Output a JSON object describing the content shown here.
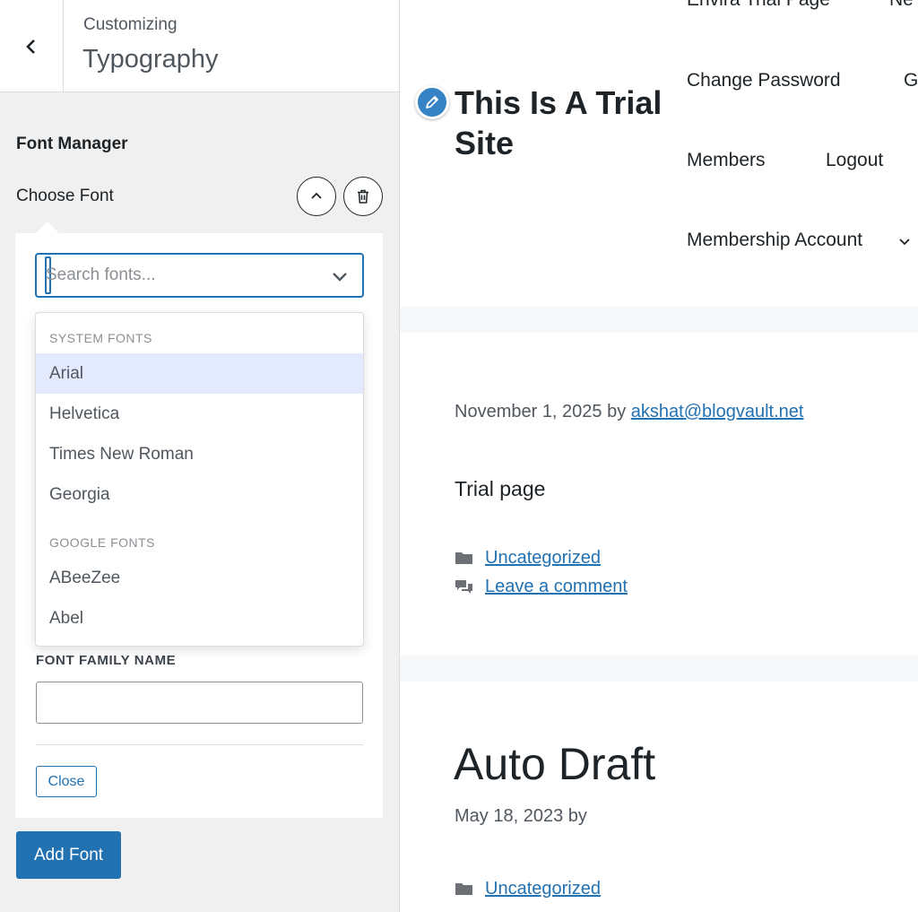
{
  "header": {
    "breadcrumb": "Customizing",
    "title": "Typography"
  },
  "font_manager": {
    "section_title": "Font Manager",
    "choose_label": "Choose Font",
    "search_placeholder": "Search fonts...",
    "groups": [
      {
        "label": "SYSTEM FONTS",
        "options": [
          "Arial",
          "Helvetica",
          "Times New Roman",
          "Georgia"
        ]
      },
      {
        "label": "GOOGLE FONTS",
        "options": [
          "ABeeZee",
          "Abel"
        ]
      }
    ],
    "highlighted_option": "Arial",
    "family_name_label": "FONT FAMILY NAME",
    "family_name_value": "",
    "close_label": "Close",
    "add_font_label": "Add Font"
  },
  "preview": {
    "site_title": "This Is A Trial Site",
    "nav": {
      "envira": "Envira Trial Page",
      "next_partial": "Ne",
      "change_password": "Change Password",
      "g_partial": "G",
      "members": "Members",
      "logout": "Logout",
      "membership_account": "Membership Account"
    },
    "post1": {
      "date": "November 1, 2025",
      "by": "by",
      "author": "akshat@blogvault.net",
      "text": "Trial page",
      "category": "Uncategorized",
      "comment_link": "Leave a comment"
    },
    "post2": {
      "title": "Auto Draft",
      "meta": "May 18, 2023 by",
      "category": "Uncategorized"
    }
  },
  "colors": {
    "accent": "#2271b1",
    "highlight": "#e3eafd",
    "pencil": "#3582c4"
  }
}
